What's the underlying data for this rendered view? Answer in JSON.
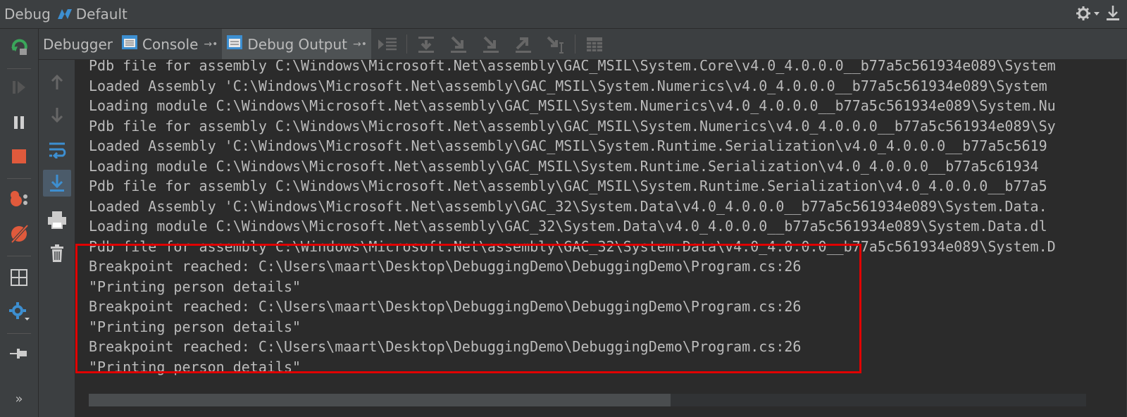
{
  "window": {
    "title_prefix": "Debug",
    "title_suffix": "Default"
  },
  "tabs": [
    {
      "label": "Debugger",
      "active": false
    },
    {
      "label": "Console",
      "active": false,
      "pin": "→•"
    },
    {
      "label": "Debug Output",
      "active": true,
      "pin": "→•"
    }
  ],
  "output": {
    "lines": [
      "Pdb file for assembly C:\\Windows\\Microsoft.Net\\assembly\\GAC_MSIL\\System.Core\\v4.0_4.0.0.0__b77a5c561934e089\\System",
      "Loaded Assembly 'C:\\Windows\\Microsoft.Net\\assembly\\GAC_MSIL\\System.Numerics\\v4.0_4.0.0.0__b77a5c561934e089\\System",
      "Loading module C:\\Windows\\Microsoft.Net\\assembly\\GAC_MSIL\\System.Numerics\\v4.0_4.0.0.0__b77a5c561934e089\\System.Nu",
      "Pdb file for assembly C:\\Windows\\Microsoft.Net\\assembly\\GAC_MSIL\\System.Numerics\\v4.0_4.0.0.0__b77a5c561934e089\\Sy",
      "Loaded Assembly 'C:\\Windows\\Microsoft.Net\\assembly\\GAC_MSIL\\System.Runtime.Serialization\\v4.0_4.0.0.0__b77a5c5619",
      "Loading module C:\\Windows\\Microsoft.Net\\assembly\\GAC_MSIL\\System.Runtime.Serialization\\v4.0_4.0.0.0__b77a5c61934",
      "Pdb file for assembly C:\\Windows\\Microsoft.Net\\assembly\\GAC_MSIL\\System.Runtime.Serialization\\v4.0_4.0.0.0__b77a5",
      "Loaded Assembly 'C:\\Windows\\Microsoft.Net\\assembly\\GAC_32\\System.Data\\v4.0_4.0.0.0__b77a5c561934e089\\System.Data.",
      "Loading module C:\\Windows\\Microsoft.Net\\assembly\\GAC_32\\System.Data\\v4.0_4.0.0.0__b77a5c561934e089\\System.Data.dl",
      "Pdb file for assembly C:\\Windows\\Microsoft.Net\\assembly\\GAC_32\\System.Data\\v4.0_4.0.0.0__b77a5c561934e089\\System.D",
      "Breakpoint reached: C:\\Users\\maart\\Desktop\\DebuggingDemo\\DebuggingDemo\\Program.cs:26",
      "\"Printing person details\"",
      "Breakpoint reached: C:\\Users\\maart\\Desktop\\DebuggingDemo\\DebuggingDemo\\Program.cs:26",
      "\"Printing person details\"",
      "Breakpoint reached: C:\\Users\\maart\\Desktop\\DebuggingDemo\\DebuggingDemo\\Program.cs:26",
      "\"Printing person details\""
    ]
  },
  "colors": {
    "background": "#2b2b2b",
    "panel": "#3c3f41",
    "text": "#bbbbbb",
    "highlight_border": "#e00000",
    "accent_green": "#3aa65a",
    "accent_red": "#e05a3c",
    "accent_blue": "#3d8fd1"
  },
  "icons": {
    "title_logo": "dotnet-logo-icon",
    "settings": "gear-icon",
    "minimize": "hide-panel-icon"
  }
}
